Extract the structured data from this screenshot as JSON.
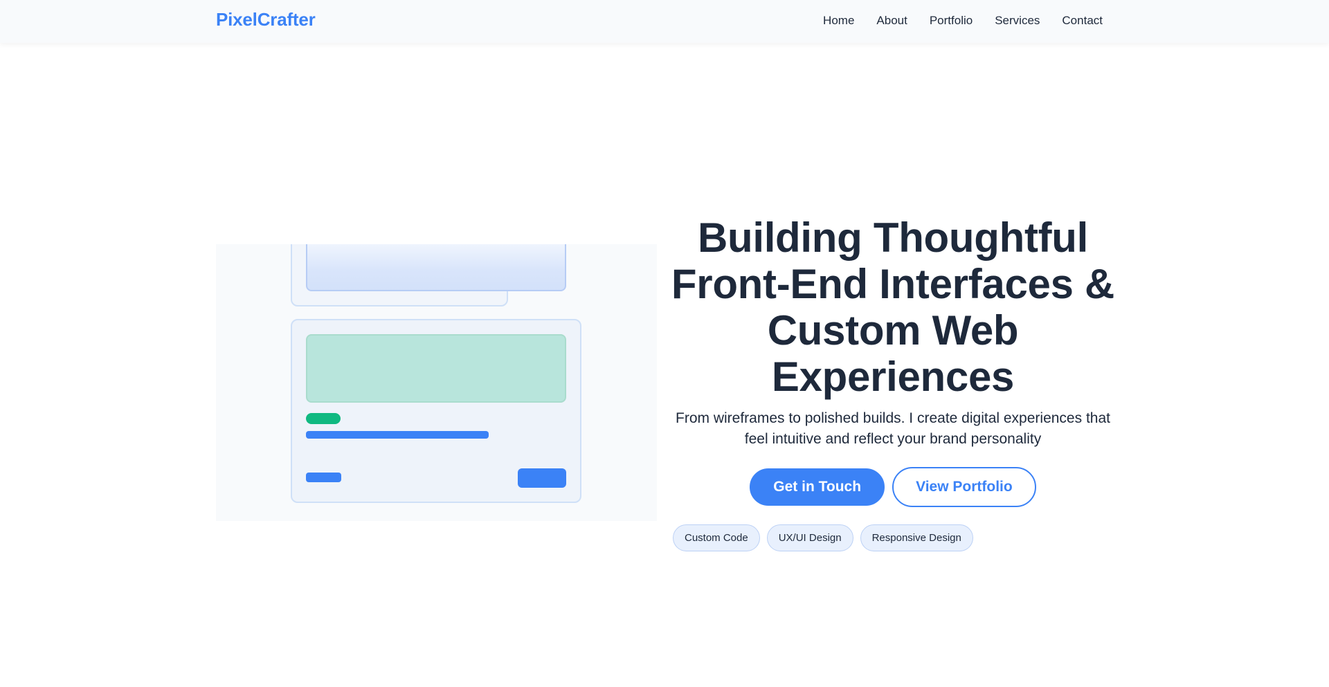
{
  "brand": {
    "name": "PixelCrafter"
  },
  "nav": {
    "links": [
      "Home",
      "About",
      "Portfolio",
      "Services",
      "Contact"
    ]
  },
  "hero": {
    "title": "Building Thoughtful Front-End Interfaces & Custom Web Experiences",
    "subtitle": "From wireframes to polished builds. I create digital experiences that feel intuitive and reflect your brand personality",
    "primary_cta": "Get in Touch",
    "secondary_cta": "View Portfolio",
    "tags": [
      "Custom Code",
      "UX/UI Design",
      "Responsive Design"
    ]
  },
  "colors": {
    "accent": "#3b82f6",
    "success": "#10b981",
    "text": "#1e293b",
    "navbar_bg": "#f8fafc"
  }
}
